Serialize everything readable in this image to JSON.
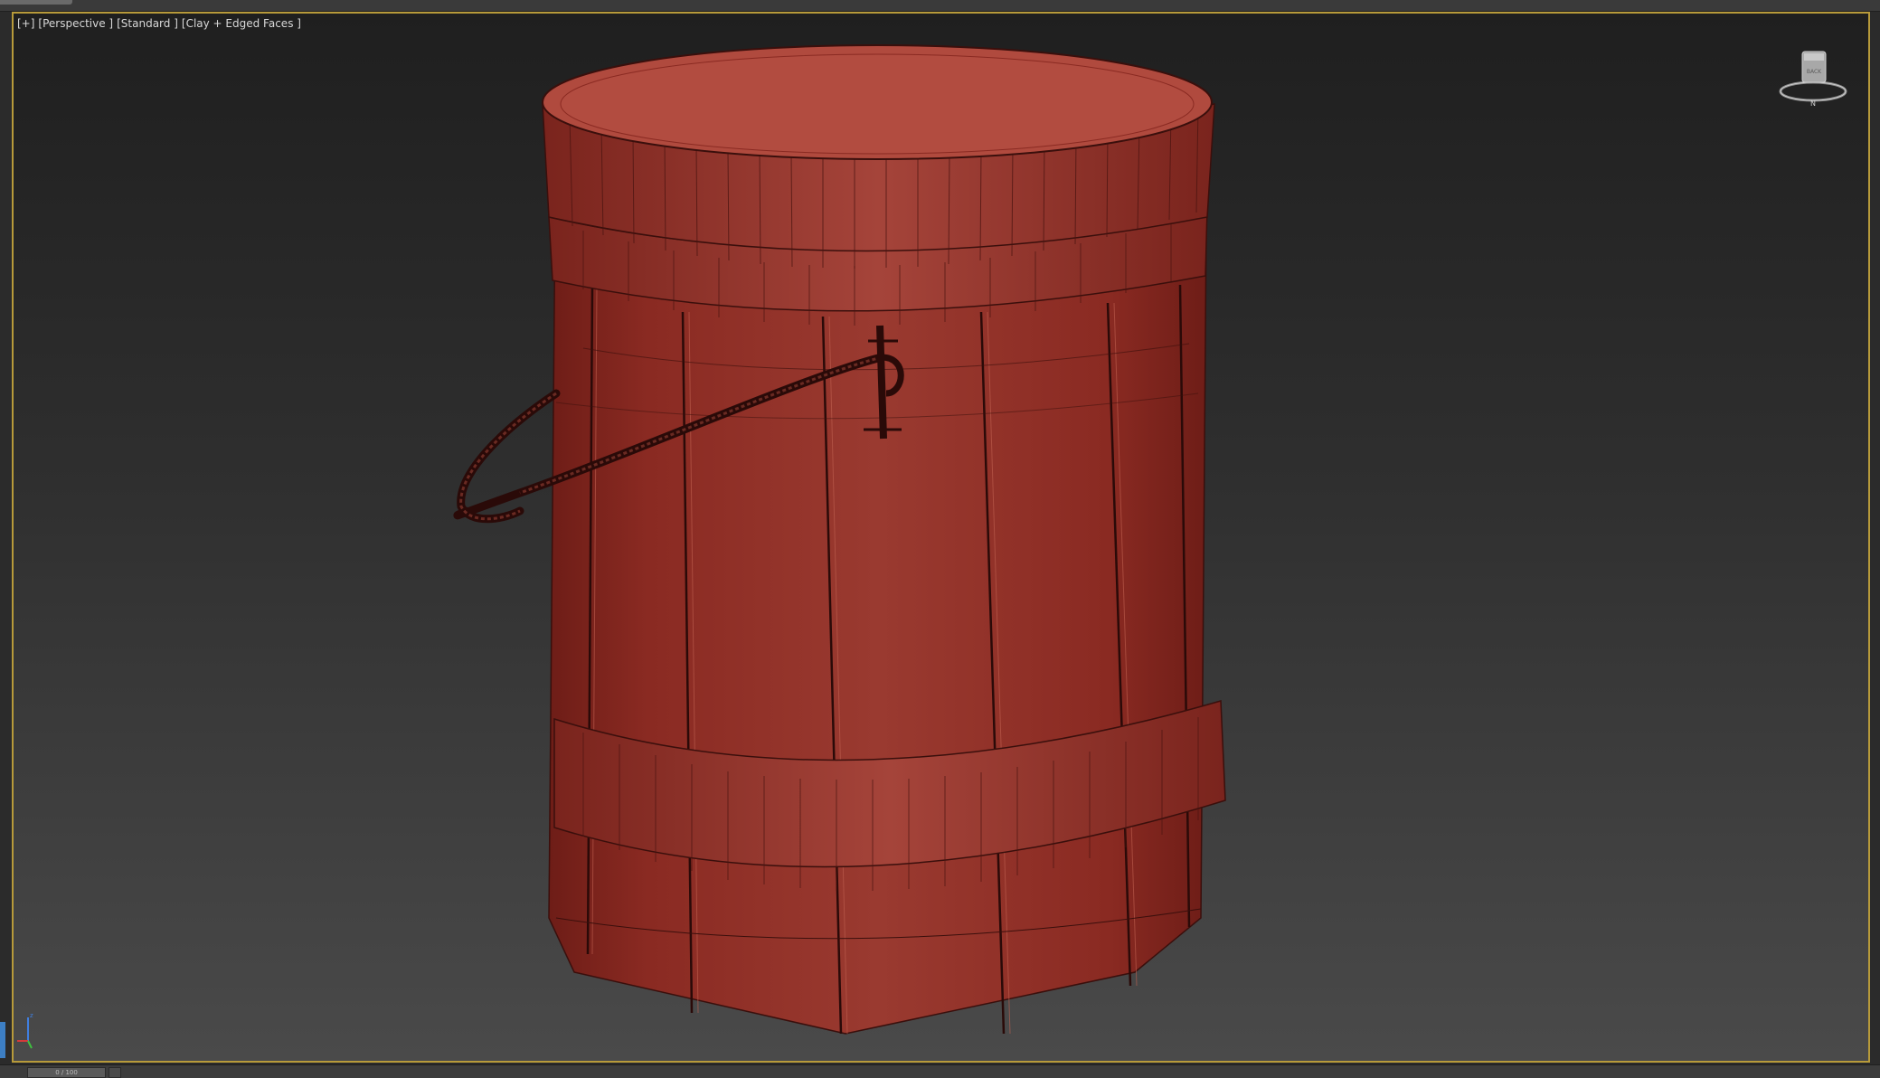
{
  "viewport": {
    "label_plus": "[+]",
    "label_view": "[Perspective ]",
    "label_shading": "[Standard ]",
    "label_style": "[Clay + Edged Faces ]"
  },
  "viewcube": {
    "face_label": "BACK",
    "compass_label": "N"
  },
  "timeline": {
    "frame_text": "0 / 100"
  },
  "scene": {
    "object": "bucket",
    "body_color": "#8e2f26",
    "top_color": "#b24c40",
    "rope_color": "#3a0f0c"
  },
  "colors": {
    "viewport_border": "#b79a3a",
    "axis_x": "#d63a3a",
    "axis_y": "#3fbf3f",
    "axis_z": "#3f7fe0"
  }
}
